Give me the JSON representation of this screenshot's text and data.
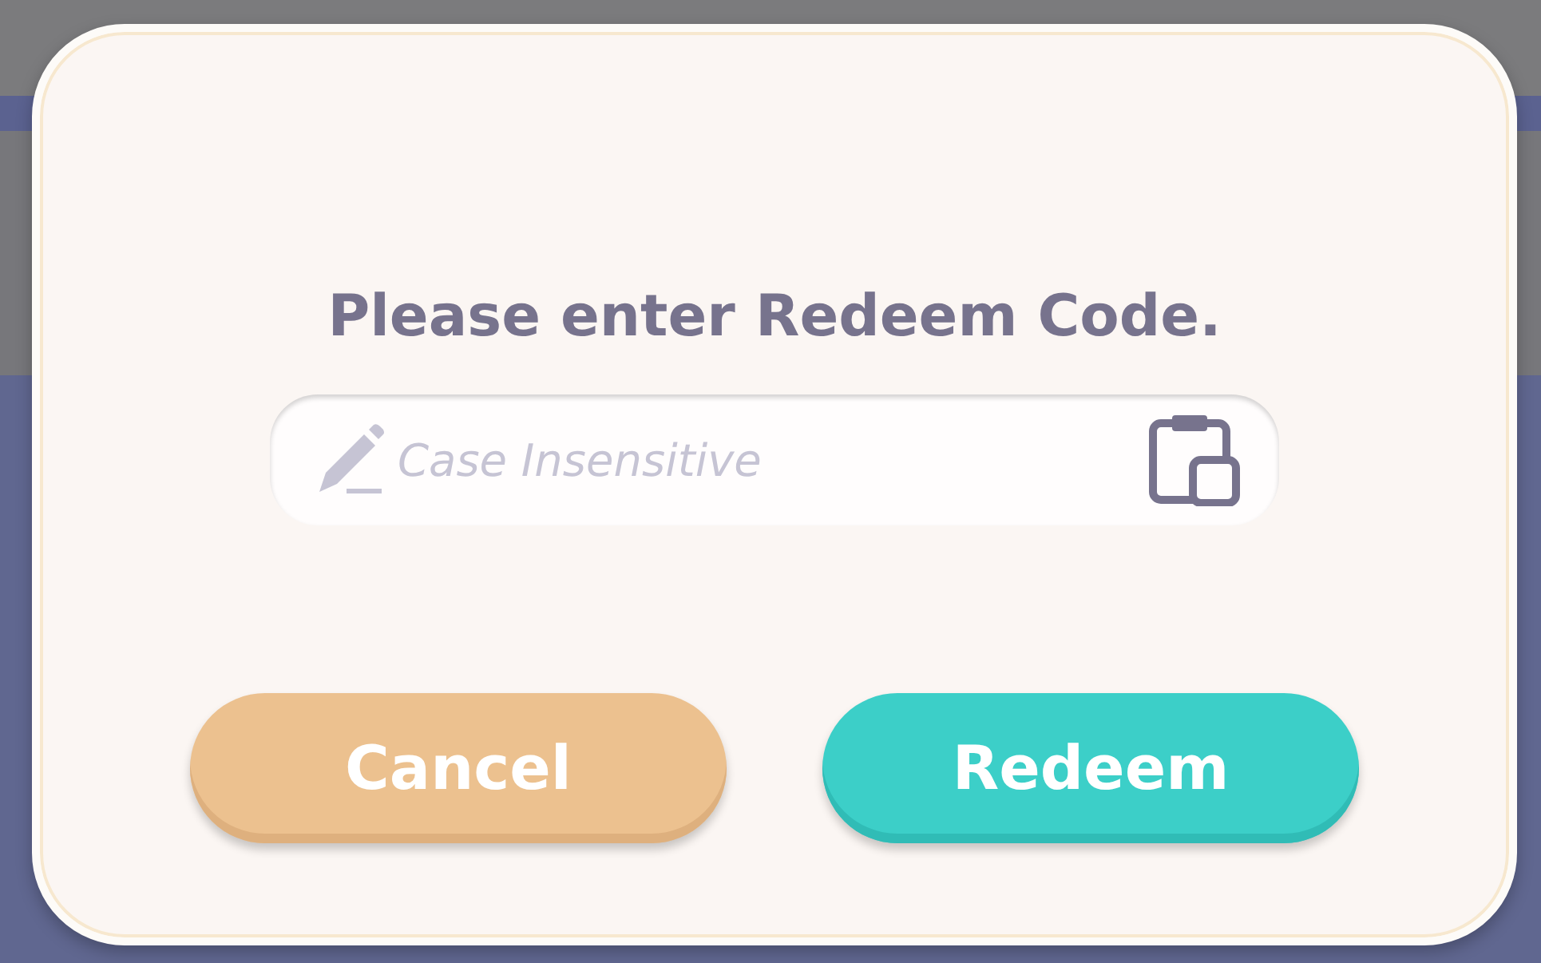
{
  "dialog": {
    "title": "Please enter Redeem Code.",
    "field": {
      "placeholder": "Case Insensitive"
    },
    "buttons": [
      {
        "label": "Cancel",
        "kind": "secondary"
      },
      {
        "label": "Redeem",
        "kind": "primary"
      }
    ]
  }
}
